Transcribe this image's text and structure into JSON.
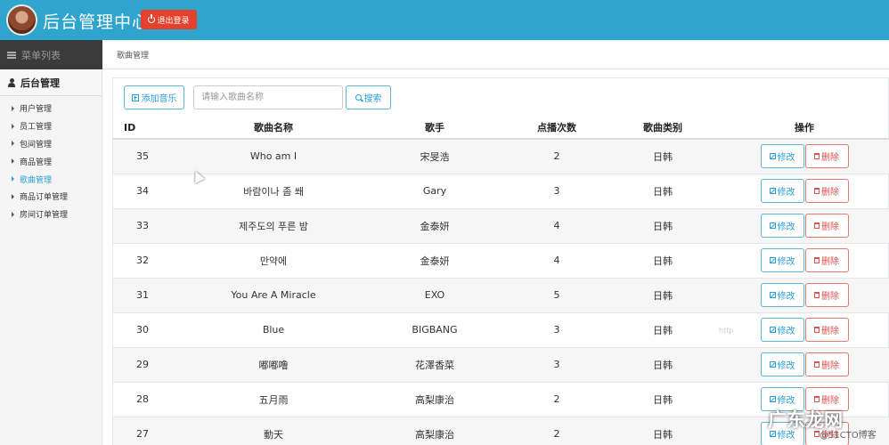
{
  "header": {
    "title": "后台管理中心",
    "logout_label": "退出登录"
  },
  "subheader": {
    "left_label": "菜单列表",
    "breadcrumb": "歌曲管理"
  },
  "sidebar": {
    "heading": "后台管理",
    "items": [
      {
        "label": "用户管理",
        "active": false
      },
      {
        "label": "员工管理",
        "active": false
      },
      {
        "label": "包间管理",
        "active": false
      },
      {
        "label": "商品管理",
        "active": false
      },
      {
        "label": "歌曲管理",
        "active": true
      },
      {
        "label": "商品订单管理",
        "active": false
      },
      {
        "label": "房间订单管理",
        "active": false
      }
    ]
  },
  "toolbar": {
    "add_label": "添加音乐",
    "search_placeholder": "请输入歌曲名称",
    "search_label": "搜索"
  },
  "table": {
    "headers": [
      "ID",
      "歌曲名称",
      "歌手",
      "点播次数",
      "歌曲类别",
      "操作"
    ],
    "edit_label": "修改",
    "delete_label": "删除",
    "rows": [
      {
        "id": "35",
        "name": "Who am I",
        "singer": "宋旻浩",
        "plays": "2",
        "category": "日韩"
      },
      {
        "id": "34",
        "name": "바람이나 좀 쐐",
        "singer": "Gary",
        "plays": "3",
        "category": "日韩"
      },
      {
        "id": "33",
        "name": "제주도의 푸른 밤",
        "singer": "金泰妍",
        "plays": "4",
        "category": "日韩"
      },
      {
        "id": "32",
        "name": "만약에",
        "singer": "金泰妍",
        "plays": "4",
        "category": "日韩"
      },
      {
        "id": "31",
        "name": "You Are A Miracle",
        "singer": "EXO",
        "plays": "5",
        "category": "日韩"
      },
      {
        "id": "30",
        "name": "Blue",
        "singer": "BIGBANG",
        "plays": "3",
        "category": "日韩"
      },
      {
        "id": "29",
        "name": "嘟嘟噜",
        "singer": "花澤香菜",
        "plays": "3",
        "category": "日韩"
      },
      {
        "id": "28",
        "name": "五月雨",
        "singer": "高梨康治",
        "plays": "2",
        "category": "日韩"
      },
      {
        "id": "27",
        "name": "動天",
        "singer": "高梨康治",
        "plays": "2",
        "category": "日韩"
      }
    ]
  },
  "watermark": {
    "main": "广东龙网",
    "small": "@51CTO博客",
    "faint": "http"
  },
  "colors": {
    "header_bg": "#2fa4cc",
    "logout_bg": "#e4422d",
    "accent": "#2a9fd6",
    "danger": "#d9534f"
  }
}
